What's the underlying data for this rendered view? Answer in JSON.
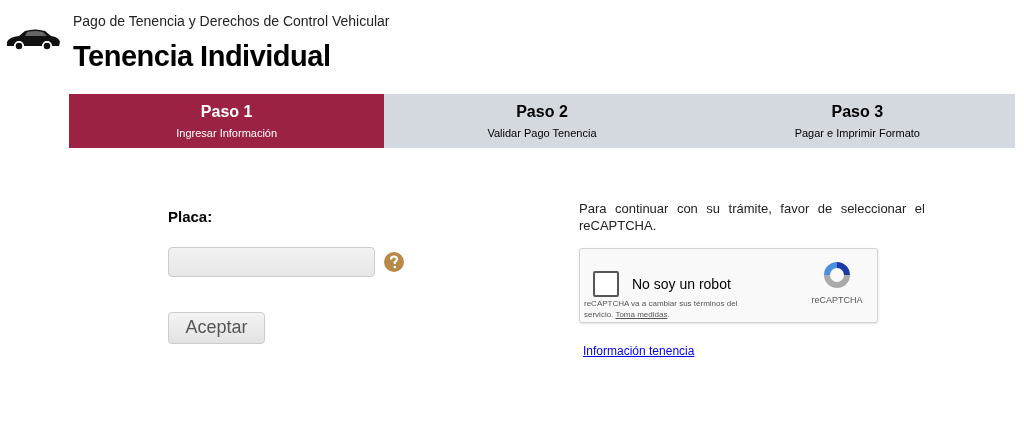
{
  "header": {
    "subtitle": "Pago de Tenencia y Derechos de Control Vehicular",
    "title": "Tenencia Individual"
  },
  "steps": [
    {
      "label": "Paso 1",
      "caption": "Ingresar Información",
      "selected": true
    },
    {
      "label": "Paso 2",
      "caption": "Validar Pago Tenencia",
      "selected": false
    },
    {
      "label": "Paso 3",
      "caption": "Pagar e Imprimir Formato",
      "selected": false
    }
  ],
  "form": {
    "label": "Placa:",
    "button": "Aceptar"
  },
  "captcha": {
    "instruction": "Para continuar con su trámite, favor de seleccionar el reCAPTCHA.",
    "checkbox_label": "No soy un robot",
    "checked": false,
    "brand": "reCAPTCHA",
    "notice": "reCAPTCHA va a cambiar sus términos del servicio.",
    "notice_link": "Toma medidas",
    "notice_end": "."
  },
  "info_link": "Información tenencia"
}
